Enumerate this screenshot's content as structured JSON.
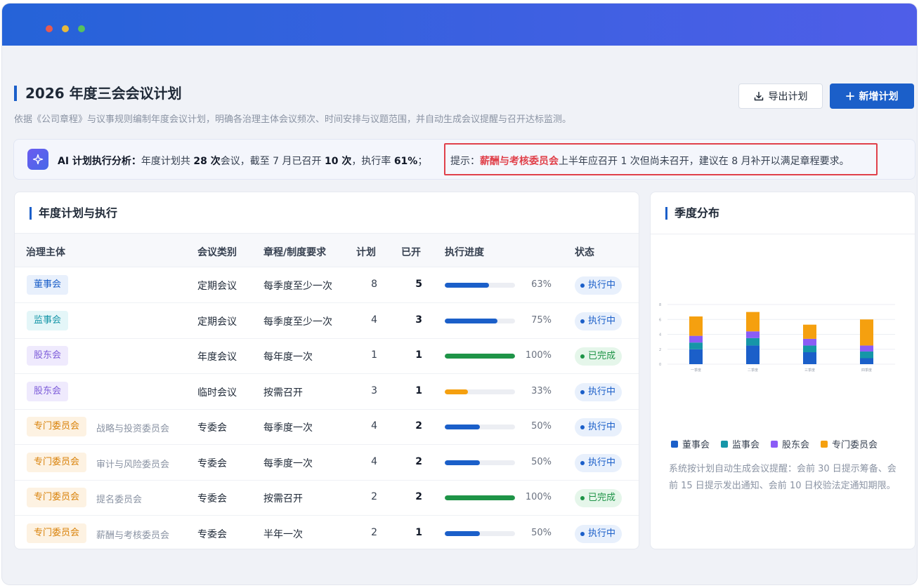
{
  "page": {
    "title": "2026 年度三会会议计划",
    "description": "依据《公司章程》与议事规则编制年度会议计划，明确各治理主体会议频次、时间安排与议题范围，并自动生成会议提醒与召开达标监测。",
    "export_label": "导出计划",
    "new_label": "新增计划"
  },
  "ai": {
    "label": "AI 计划执行分析：",
    "t1": "年度计划共",
    "total": "28 次",
    "t2": "会议，截至 7 月已召开",
    "held": "10 次",
    "t3": "，执行率",
    "rate": "61%",
    "t4": "；",
    "hint_prefix": "提示：",
    "hint_subject": "薪酬与考核委员会",
    "hint_body": "上半年应召开 1 次但尚未召开，建议在 8 月补开以满足章程要求。"
  },
  "colors": {
    "board": "#1b5fc9",
    "supervisory": "#1696a8",
    "shareholder": "#8b5cf6",
    "committee": "#f5a00f",
    "progress_normal": "#1b5fc9",
    "progress_complete": "#1e9447",
    "progress_low": "#f5a00f"
  },
  "table": {
    "title": "年度计划与执行",
    "headers": [
      "治理主体",
      "会议类别",
      "章程/制度要求",
      "计划",
      "已开",
      "执行进度",
      "状态"
    ],
    "rows": [
      {
        "subject": "董事会",
        "subject_kind": "board",
        "committee": "",
        "type": "定期会议",
        "requirement": "每季度至少一次",
        "plan": "8",
        "held": "5",
        "progress": 63,
        "progress_label": "63%",
        "progress_color": "normal",
        "status": "执行中",
        "status_kind": "run"
      },
      {
        "subject": "监事会",
        "subject_kind": "super",
        "committee": "",
        "type": "定期会议",
        "requirement": "每季度至少一次",
        "plan": "4",
        "held": "3",
        "progress": 75,
        "progress_label": "75%",
        "progress_color": "normal",
        "status": "执行中",
        "status_kind": "run"
      },
      {
        "subject": "股东会",
        "subject_kind": "share",
        "committee": "",
        "type": "年度会议",
        "requirement": "每年度一次",
        "plan": "1",
        "held": "1",
        "progress": 100,
        "progress_label": "100%",
        "progress_color": "complete",
        "status": "已完成",
        "status_kind": "done"
      },
      {
        "subject": "股东会",
        "subject_kind": "share",
        "committee": "",
        "type": "临时会议",
        "requirement": "按需召开",
        "plan": "3",
        "held": "1",
        "progress": 33,
        "progress_label": "33%",
        "progress_color": "low",
        "status": "执行中",
        "status_kind": "run"
      },
      {
        "subject": "专门委员会",
        "subject_kind": "comm",
        "committee": "战略与投资委员会",
        "type": "专委会",
        "requirement": "每季度一次",
        "plan": "4",
        "held": "2",
        "progress": 50,
        "progress_label": "50%",
        "progress_color": "normal",
        "status": "执行中",
        "status_kind": "run"
      },
      {
        "subject": "专门委员会",
        "subject_kind": "comm",
        "committee": "审计与风险委员会",
        "type": "专委会",
        "requirement": "每季度一次",
        "plan": "4",
        "held": "2",
        "progress": 50,
        "progress_label": "50%",
        "progress_color": "normal",
        "status": "执行中",
        "status_kind": "run"
      },
      {
        "subject": "专门委员会",
        "subject_kind": "comm",
        "committee": "提名委员会",
        "type": "专委会",
        "requirement": "按需召开",
        "plan": "2",
        "held": "2",
        "progress": 100,
        "progress_label": "100%",
        "progress_color": "complete",
        "status": "已完成",
        "status_kind": "done"
      },
      {
        "subject": "专门委员会",
        "subject_kind": "comm",
        "committee": "薪酬与考核委员会",
        "type": "专委会",
        "requirement": "半年一次",
        "plan": "2",
        "held": "1",
        "progress": 50,
        "progress_label": "50%",
        "progress_color": "normal",
        "status": "执行中",
        "status_kind": "run"
      }
    ]
  },
  "side": {
    "title": "季度分布",
    "note": "系统按计划自动生成会议提醒：会前 30 日提示筹备、会前 15 日提示发出通知、会前 10 日校验法定通知期限。"
  },
  "chart_data": {
    "type": "bar",
    "stacked": true,
    "categories": [
      "一季度",
      "二季度",
      "三季度",
      "四季度"
    ],
    "ylim": [
      0,
      8
    ],
    "yticks": [
      "0",
      "2",
      "4",
      "6",
      "8"
    ],
    "grid": true,
    "legend_position": "bottom",
    "series": [
      {
        "name": "董事会",
        "color": "#1b5fc9",
        "values": [
          2,
          2.5,
          1.6,
          0.8
        ]
      },
      {
        "name": "监事会",
        "color": "#1696a8",
        "values": [
          0.9,
          1,
          0.9,
          0.9
        ]
      },
      {
        "name": "股东会",
        "color": "#8b5cf6",
        "values": [
          0.9,
          0.9,
          0.9,
          0.8
        ]
      },
      {
        "name": "专门委员会",
        "color": "#f5a00f",
        "values": [
          2.6,
          2.6,
          1.9,
          3.5
        ]
      }
    ]
  }
}
